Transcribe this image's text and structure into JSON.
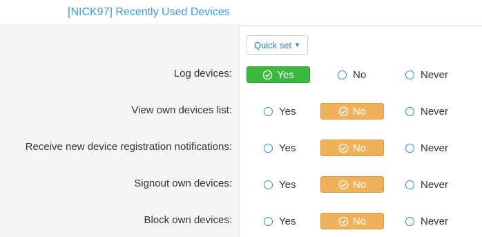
{
  "header": {
    "title": "[NICK97] Recently Used Devices"
  },
  "quick_set": {
    "label": "Quick set",
    "icon": "caret-down-icon"
  },
  "options": {
    "yes": "Yes",
    "no": "No",
    "never": "Never"
  },
  "colors": {
    "accent": "#3a9ad9",
    "selected_green": "#3cb83c",
    "selected_orange": "#efb15a"
  },
  "rows": [
    {
      "label": "Log devices:",
      "selected": "Yes"
    },
    {
      "label": "View own devices list:",
      "selected": "No"
    },
    {
      "label": "Receive new device registration notifications:",
      "selected": "No"
    },
    {
      "label": "Signout own devices:",
      "selected": "No"
    },
    {
      "label": "Block own devices:",
      "selected": "No"
    }
  ]
}
